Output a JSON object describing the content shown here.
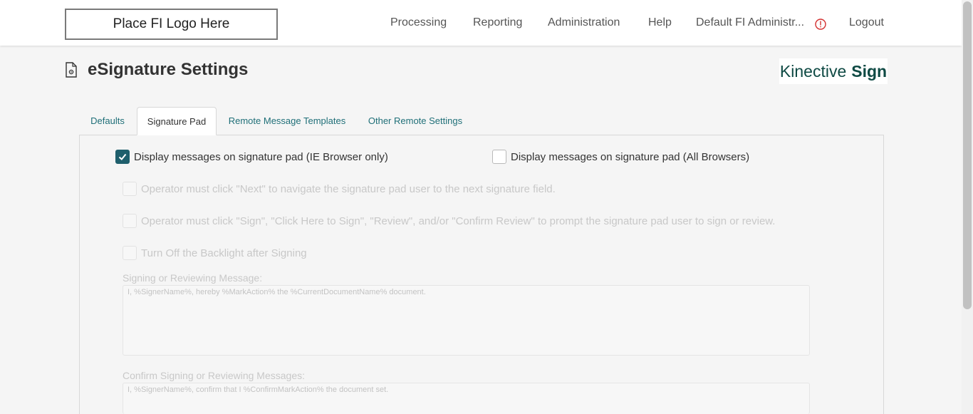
{
  "header": {
    "logo_text": "Place FI Logo Here",
    "nav": {
      "processing": "Processing",
      "reporting": "Reporting",
      "administration": "Administration",
      "help": "Help",
      "user": "Default FI Administr...",
      "logout": "Logout"
    },
    "alert_color": "#d32f2f"
  },
  "page": {
    "title": "eSignature Settings",
    "brand_light": "Kinective",
    "brand_bold": "Sign",
    "brand_color": "#0f4a44"
  },
  "tabs": {
    "defaults": "Defaults",
    "signature_pad": "Signature Pad",
    "remote_message_templates": "Remote Message Templates",
    "other_remote_settings": "Other Remote Settings",
    "active": "Signature Pad"
  },
  "options": {
    "display_ie": {
      "label": "Display messages on signature pad (IE Browser only)",
      "checked": true
    },
    "display_all": {
      "label": "Display messages on signature pad (All Browsers)",
      "checked": false
    },
    "operator_next": {
      "label": "Operator must click \"Next\" to navigate the signature pad user to the next signature field.",
      "checked": false,
      "disabled": true
    },
    "operator_sign": {
      "label": "Operator must click \"Sign\", \"Click Here to Sign\", \"Review\", and/or \"Confirm Review\" to prompt the signature pad user to sign or review.",
      "checked": false,
      "disabled": true
    },
    "backlight": {
      "label": "Turn Off the Backlight after Signing",
      "checked": false,
      "disabled": true
    }
  },
  "fields": {
    "signing_message": {
      "label": "Signing or Reviewing Message:",
      "value": "I, %SignerName%, hereby %MarkAction% the %CurrentDocumentName% document."
    },
    "confirm_message": {
      "label": "Confirm Signing or Reviewing Messages:",
      "value": "I, %SignerName%, confirm that I %ConfirmMarkAction% the document set."
    }
  },
  "accent_color": "#1f5f6c"
}
